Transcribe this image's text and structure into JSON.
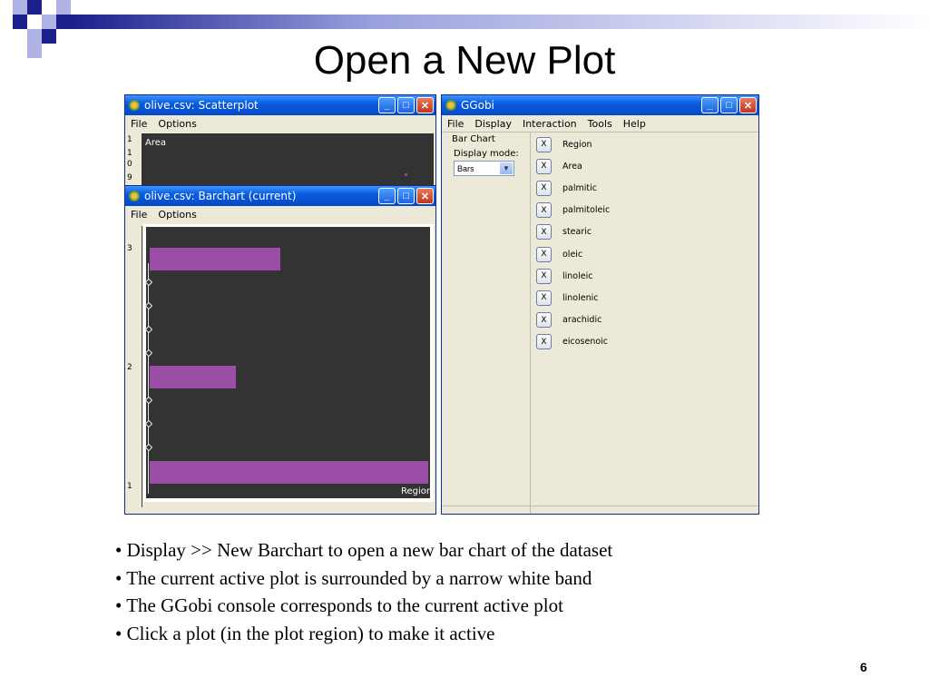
{
  "slide": {
    "title": "Open a New Plot",
    "page_number": "6",
    "bullets": [
      "• Display >> New Barchart to open a new bar chart of the dataset",
      "• The current active plot is surrounded by a narrow white band",
      "• The GGobi console corresponds to the current active plot",
      "• Click a plot (in the plot region) to make it active"
    ]
  },
  "scatter_window": {
    "title": "olive.csv: Scatterplot",
    "menu": [
      "File",
      "Options"
    ],
    "axis_label": "Area",
    "ruler_labels": [
      "1",
      "1",
      "0",
      "9"
    ]
  },
  "barchart_window": {
    "title": "olive.csv: Barchart (current)",
    "menu": [
      "File",
      "Options"
    ],
    "ruler_labels": [
      "3",
      "2",
      "1"
    ],
    "region_label": "Region",
    "bar_lengths": {
      "3": 0.47,
      "2": 0.31,
      "1": 1.0
    }
  },
  "ggobi_window": {
    "title": "GGobi",
    "menu": [
      "File",
      "Display",
      "Interaction",
      "Tools",
      "Help"
    ],
    "panel_heading": "Bar Chart",
    "display_mode_label": "Display mode:",
    "display_mode_value": "Bars",
    "variables": [
      "Region",
      "Area",
      "palmitic",
      "palmitoleic",
      "stearic",
      "oleic",
      "linoleic",
      "linolenic",
      "arachidic",
      "eicosenoic"
    ],
    "variable_button_label": "X"
  },
  "window_buttons": {
    "minimize": "_",
    "maximize": "□",
    "close": "✕"
  },
  "colors": {
    "bar": "#9b4ea6",
    "plot_bg": "#333333",
    "titlebar": "#0a5cde"
  }
}
